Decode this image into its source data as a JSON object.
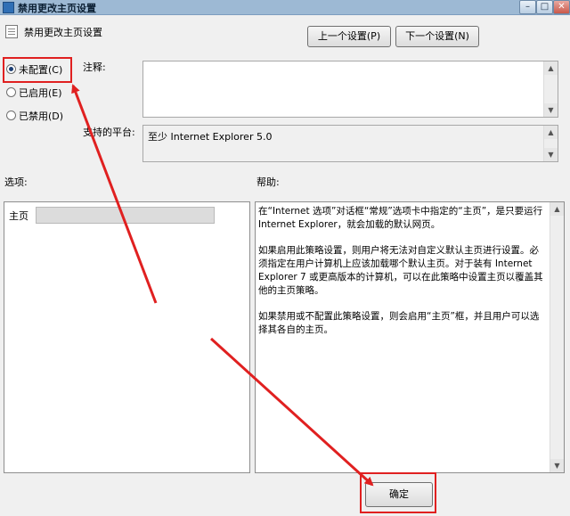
{
  "window": {
    "title": "禁用更改主页设置",
    "controls": [
      "–",
      "□",
      "✕"
    ]
  },
  "header": {
    "policy_name": "禁用更改主页设置"
  },
  "nav": {
    "prev_label": "上一个设置(P)",
    "next_label": "下一个设置(N)"
  },
  "state": {
    "options": [
      {
        "label": "未配置(C)",
        "selected": true
      },
      {
        "label": "已启用(E)",
        "selected": false
      },
      {
        "label": "已禁用(D)",
        "selected": false
      }
    ]
  },
  "comment": {
    "label": "注释:",
    "value": ""
  },
  "platform": {
    "label": "支持的平台:",
    "value": "至少 Internet Explorer 5.0"
  },
  "options_section": {
    "label": "选项:",
    "home_label": "主页",
    "home_value": ""
  },
  "help": {
    "label": "帮助:",
    "paragraphs": [
      "在“Internet 选项”对话框“常规”选项卡中指定的“主页”，是只要运行 Internet Explorer，就会加载的默认网页。",
      "如果启用此策略设置，则用户将无法对自定义默认主页进行设置。必须指定在用户计算机上应该加载哪个默认主页。对于装有 Internet Explorer 7 或更高版本的计算机，可以在此策略中设置主页以覆盖其他的主页策略。",
      "如果禁用或不配置此策略设置，则会启用“主页”框，并且用户可以选择其各自的主页。"
    ]
  },
  "footer": {
    "ok_label": "确定"
  },
  "colors": {
    "annotation": "#e02020",
    "titlebar": "#9db9d4"
  },
  "icons": [
    "policy-settings-icon",
    "scroll-up-icon",
    "scroll-down-icon"
  ]
}
